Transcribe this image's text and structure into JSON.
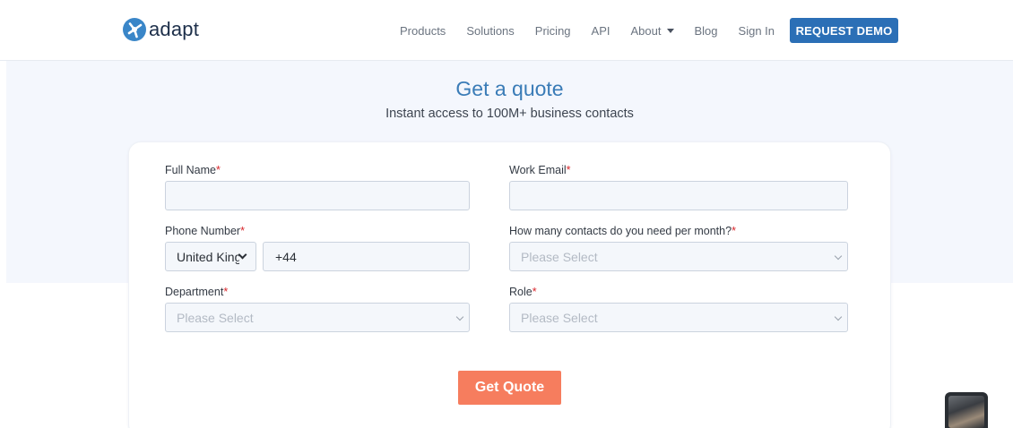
{
  "header": {
    "logo_text": "adapt",
    "nav": [
      "Products",
      "Solutions",
      "Pricing",
      "API",
      "About",
      "Blog",
      "Sign In"
    ],
    "demo_label": "REQUEST DEMO"
  },
  "hero": {
    "title": "Get a quote",
    "subtitle": "Instant access to 100M+ business contacts"
  },
  "form": {
    "full_name_label": "Full Name",
    "work_email_label": "Work Email",
    "phone_label": "Phone Number",
    "contacts_label": "How many contacts do you need per month?",
    "department_label": "Department",
    "role_label": "Role",
    "required_mark": "*",
    "country_value": "United Kingdom",
    "phone_prefix": "+44",
    "select_placeholder": "Please Select",
    "submit_label": "Get Quote"
  },
  "colors": {
    "brand_blue": "#2b6fb6",
    "title_blue": "#3a7cb7",
    "cta_orange": "#f67d5e",
    "required_red": "#d8262b"
  }
}
